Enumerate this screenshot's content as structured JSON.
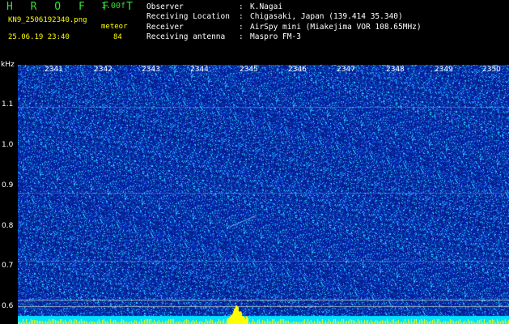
{
  "header": {
    "app_title": "H R O F F T",
    "version": "1.00f",
    "filename": "KN9_2506192340.png",
    "meteor_label": "meteor",
    "datetime": "25.06.19 23:40",
    "meteor_count": "84"
  },
  "info": [
    {
      "key": "Observer",
      "value": "K.Nagai"
    },
    {
      "key": "Receiving Location",
      "value": "Chigasaki, Japan (139.414 35.340)"
    },
    {
      "key": "Receiver",
      "value": "AirSpy mini (Miakejima VOR 108.65MHz)"
    },
    {
      "key": "Receiving antenna",
      "value": "Maspro FM-3"
    }
  ],
  "spectrogram": {
    "y_unit": "kHz",
    "y_ticks": [
      "1.1",
      "1.0",
      "0.9",
      "0.8",
      "0.7",
      "0.6"
    ],
    "x_ticks": [
      "2341",
      "2342",
      "2343",
      "2344",
      "2345",
      "2346",
      "2347",
      "2348",
      "2349",
      "2350"
    ],
    "colors": {
      "background": "#0a1a9a",
      "noise": "#30b0ff",
      "signal": "#ffff00",
      "band": "#00e0ff"
    }
  }
}
